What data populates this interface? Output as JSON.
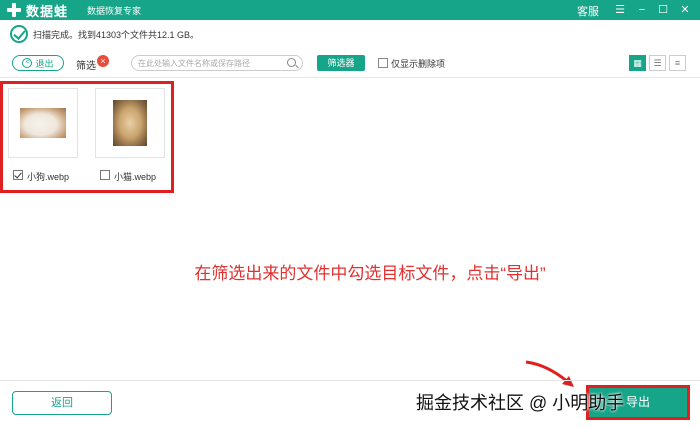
{
  "titlebar": {
    "logo_text": "数据蛙",
    "subtitle": "数据恢复专家",
    "service": "客服",
    "menu_icon": "hamburger-icon",
    "minimize_icon": "minimize-icon",
    "maximize_icon": "maximize-icon",
    "close_icon": "close-icon"
  },
  "status": {
    "text": "扫描完成。找到41303个文件共12.1 GB。"
  },
  "toolbar": {
    "exit_label": "退出",
    "filter_label": "筛选",
    "search_placeholder": "在此处输入文件名称或保存路径",
    "filter_button": "筛选器",
    "deleted_only_label": "仅显示删除项",
    "deleted_only_checked": false
  },
  "files": [
    {
      "name": "小狗.webp",
      "checked": true,
      "thumb": "dog"
    },
    {
      "name": "小猫.webp",
      "checked": false,
      "thumb": "cat"
    }
  ],
  "annotation": "在筛选出来的文件中勾选目标文件，点击“导出”",
  "bottom": {
    "back_label": "返回",
    "watermark": "掘金技术社区 @ 小明助手",
    "export_label": "导出"
  },
  "colors": {
    "accent": "#17a589",
    "highlight": "#e02020",
    "annotation": "#e03030"
  }
}
